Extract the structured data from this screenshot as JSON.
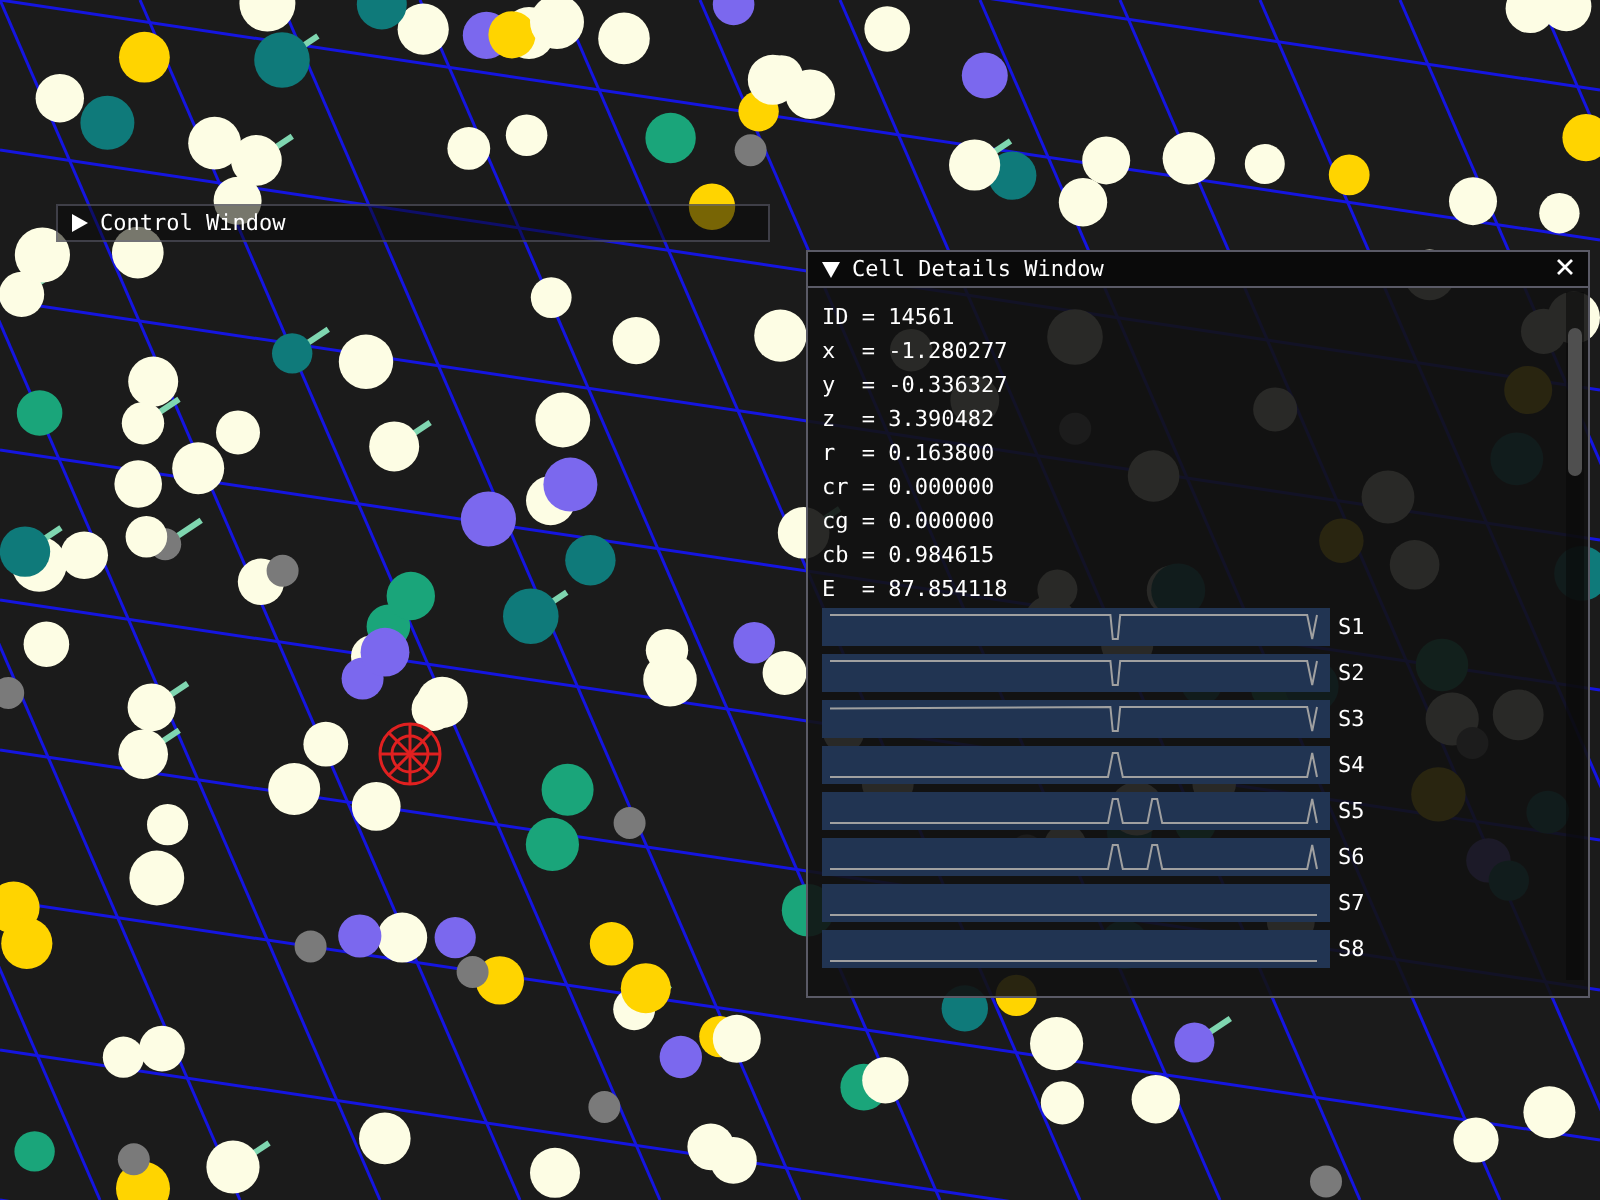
{
  "control_window": {
    "title": "Control Window",
    "expanded": false
  },
  "details_window": {
    "title": "Cell Details Window",
    "expanded": true,
    "fields": [
      "ID = 14561",
      "x  = -1.280277",
      "y  = -0.336327",
      "z  = 3.390482",
      "r  = 0.163800",
      "cr = 0.000000",
      "cg = 0.000000",
      "cb = 0.984615",
      "E  = 87.854118"
    ],
    "plots": [
      {
        "label": "S1"
      },
      {
        "label": "S2"
      },
      {
        "label": "S3"
      },
      {
        "label": "S4"
      },
      {
        "label": "S5"
      },
      {
        "label": "S6"
      },
      {
        "label": "S7"
      },
      {
        "label": "S8"
      }
    ]
  }
}
